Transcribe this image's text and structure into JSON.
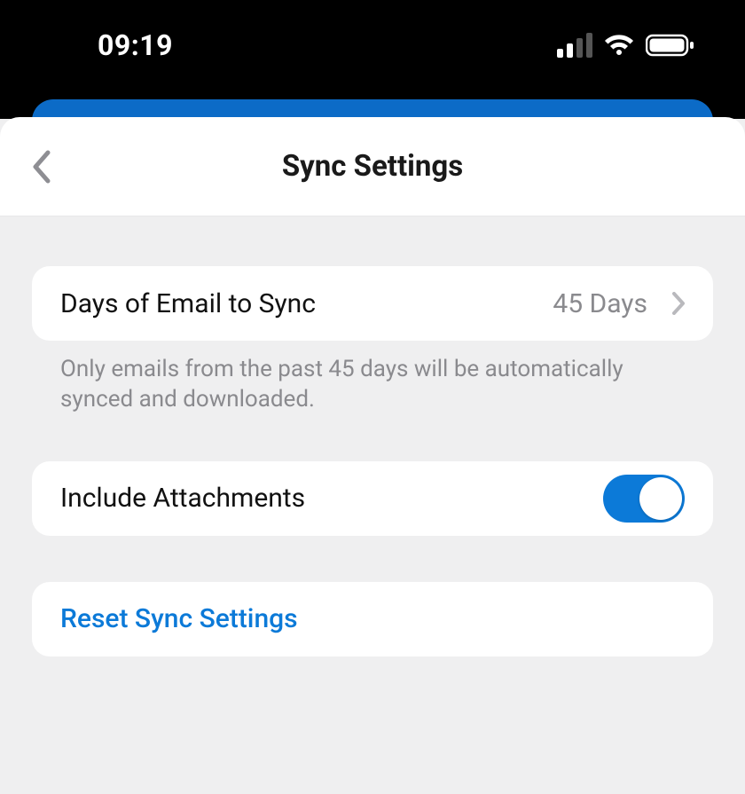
{
  "statusBar": {
    "time": "09:19"
  },
  "header": {
    "title": "Sync Settings"
  },
  "settings": {
    "daysToSync": {
      "label": "Days of Email to Sync",
      "value": "45 Days",
      "description": "Only emails from the past 45 days will be automatically synced and downloaded."
    },
    "includeAttachments": {
      "label": "Include Attachments",
      "enabled": true
    },
    "reset": {
      "label": "Reset Sync Settings"
    }
  }
}
